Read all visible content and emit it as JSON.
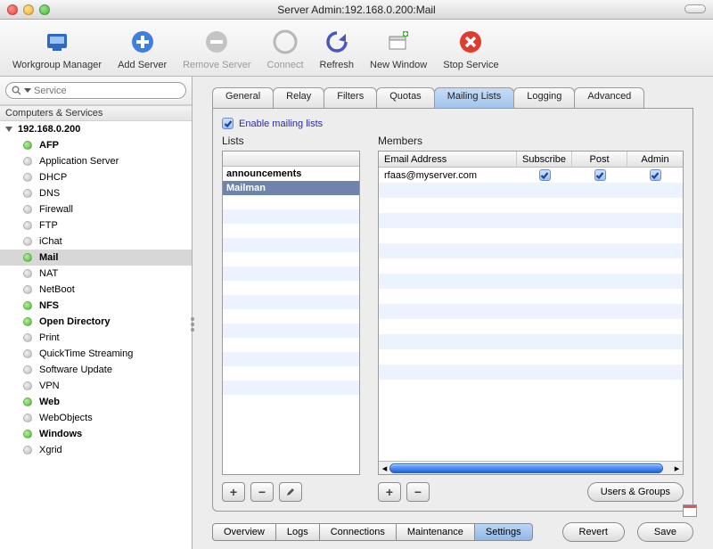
{
  "window": {
    "title": "Server Admin:192.168.0.200:Mail"
  },
  "toolbar": {
    "workgroup": "Workgroup Manager",
    "add": "Add Server",
    "remove": "Remove Server",
    "connect": "Connect",
    "refresh": "Refresh",
    "newwin": "New Window",
    "stop": "Stop Service"
  },
  "search": {
    "placeholder": "Service"
  },
  "sidebar": {
    "group": "Computers & Services",
    "host": "192.168.0.200",
    "services": [
      {
        "name": "AFP",
        "on": true,
        "bold": true
      },
      {
        "name": "Application Server",
        "on": false
      },
      {
        "name": "DHCP",
        "on": false
      },
      {
        "name": "DNS",
        "on": false
      },
      {
        "name": "Firewall",
        "on": false
      },
      {
        "name": "FTP",
        "on": false
      },
      {
        "name": "iChat",
        "on": false
      },
      {
        "name": "Mail",
        "on": true,
        "bold": true,
        "selected": true
      },
      {
        "name": "NAT",
        "on": false
      },
      {
        "name": "NetBoot",
        "on": false
      },
      {
        "name": "NFS",
        "on": true,
        "bold": true
      },
      {
        "name": "Open Directory",
        "on": true,
        "bold": true
      },
      {
        "name": "Print",
        "on": false
      },
      {
        "name": "QuickTime Streaming",
        "on": false
      },
      {
        "name": "Software Update",
        "on": false
      },
      {
        "name": "VPN",
        "on": false
      },
      {
        "name": "Web",
        "on": true,
        "bold": true
      },
      {
        "name": "WebObjects",
        "on": false
      },
      {
        "name": "Windows",
        "on": true,
        "bold": true
      },
      {
        "name": "Xgrid",
        "on": false
      }
    ]
  },
  "tabs": {
    "general": "General",
    "relay": "Relay",
    "filters": "Filters",
    "quotas": "Quotas",
    "mailing": "Mailing Lists",
    "logging": "Logging",
    "advanced": "Advanced"
  },
  "mailing": {
    "enable": "Enable mailing lists",
    "lists_label": "Lists",
    "members_label": "Members",
    "lists": [
      {
        "name": "announcements",
        "selected": false,
        "bold": true
      },
      {
        "name": "Mailman",
        "selected": true,
        "bold": false
      }
    ],
    "member_headers": {
      "email": "Email Address",
      "subscribe": "Subscribe",
      "post": "Post",
      "admin": "Admin"
    },
    "members": [
      {
        "email": "rfaas@myserver.com",
        "subscribe": true,
        "post": true,
        "admin": true
      }
    ],
    "users_groups": "Users & Groups"
  },
  "segments": {
    "overview": "Overview",
    "logs": "Logs",
    "connections": "Connections",
    "maintenance": "Maintenance",
    "settings": "Settings"
  },
  "actions": {
    "revert": "Revert",
    "save": "Save"
  }
}
